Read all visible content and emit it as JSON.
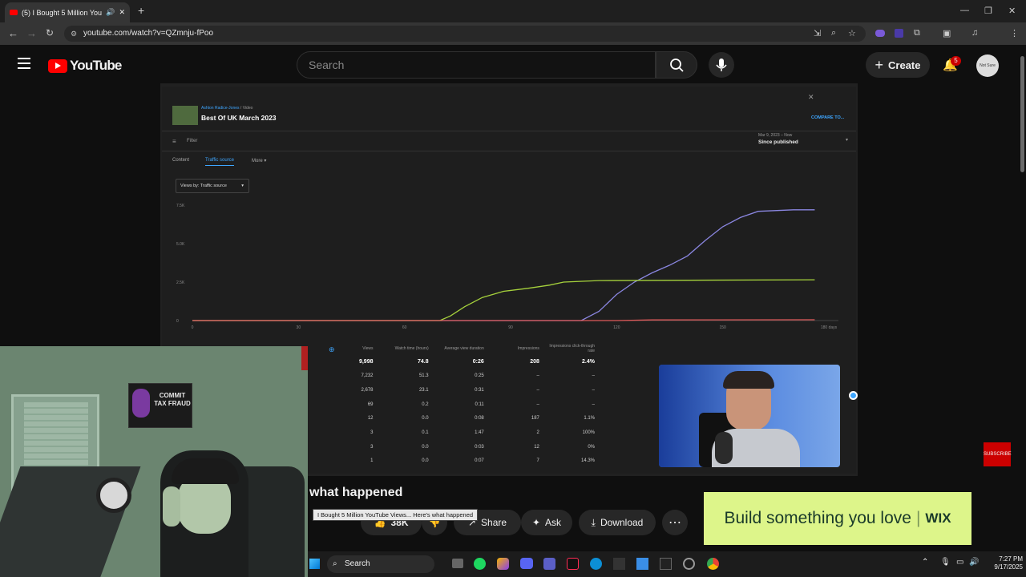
{
  "browser": {
    "tab_title": "(5) I Bought 5 Million YouTu",
    "url": "youtube.com/watch?v=QZmnju-fPoo"
  },
  "youtube": {
    "logo_text": "YouTube",
    "search_placeholder": "Search",
    "create_label": "Create",
    "notification_count": "5",
    "avatar_text": "Not Sure"
  },
  "studio": {
    "breadcrumb_channel": "Ashton Radice-Jones",
    "breadcrumb_page": "Video",
    "video_name": "Best Of UK March 2023",
    "filter_label": "Filter",
    "compare_label": "COMPARE TO...",
    "date_range_top": "Mar 9, 2023 – Now",
    "date_range_main": "Since published",
    "tabs": [
      "Content",
      "Traffic source",
      "More"
    ],
    "dropdown_label": "Views by: Traffic source",
    "table_headers": [
      "Views",
      "Watch time (hours)",
      "Average view duration",
      "Impressions",
      "Impressions click-through rate"
    ],
    "table_rows": [
      [
        "9,998",
        "74.8",
        "0:26",
        "208",
        "2.4%"
      ],
      [
        "7,232",
        "51.3",
        "0:25",
        "–",
        "–"
      ],
      [
        "2,678",
        "23.1",
        "0:31",
        "–",
        "–"
      ],
      [
        "69",
        "0.2",
        "0:11",
        "–",
        "–"
      ],
      [
        "12",
        "0.0",
        "0:08",
        "187",
        "1.1%"
      ],
      [
        "3",
        "0.1",
        "1:47",
        "2",
        "100%"
      ],
      [
        "3",
        "0.0",
        "0:03",
        "12",
        "0%"
      ],
      [
        "1",
        "0.0",
        "0:07",
        "7",
        "14.3%"
      ]
    ]
  },
  "chart_data": {
    "type": "line",
    "x": [
      0,
      30,
      60,
      90,
      120,
      150,
      180
    ],
    "x_tick_labels": [
      "0",
      "30",
      "60",
      "90",
      "120",
      "150",
      "180 days"
    ],
    "y_tick_labels": [
      "0",
      "2.5K",
      "5.0K",
      "7.5K"
    ],
    "ylim": [
      0,
      7500
    ],
    "xlim": [
      0,
      180
    ],
    "series": [
      {
        "color": "#8a86e0",
        "points": [
          [
            0,
            0
          ],
          [
            100,
            0
          ],
          [
            110,
            0
          ],
          [
            115,
            600
          ],
          [
            120,
            1700
          ],
          [
            125,
            2500
          ],
          [
            130,
            3100
          ],
          [
            135,
            3600
          ],
          [
            140,
            4200
          ],
          [
            145,
            5200
          ],
          [
            150,
            6100
          ],
          [
            155,
            6700
          ],
          [
            160,
            7100
          ],
          [
            170,
            7200
          ],
          [
            176,
            7200
          ]
        ]
      },
      {
        "color": "#a6d23c",
        "points": [
          [
            0,
            0
          ],
          [
            70,
            0
          ],
          [
            73,
            300
          ],
          [
            77,
            900
          ],
          [
            82,
            1500
          ],
          [
            88,
            1900
          ],
          [
            95,
            2100
          ],
          [
            101,
            2300
          ],
          [
            105,
            2500
          ],
          [
            115,
            2600
          ],
          [
            176,
            2650
          ]
        ]
      },
      {
        "color": "#e05a5a",
        "points": [
          [
            0,
            0
          ],
          [
            120,
            0
          ],
          [
            130,
            40
          ],
          [
            176,
            50
          ]
        ]
      }
    ]
  },
  "video": {
    "title_fragment": "what happened",
    "tooltip": "I Bought 5 Million YouTube Views... Here's what happened",
    "likes": "38K",
    "share_label": "Share",
    "ask_label": "Ask",
    "download_label": "Download",
    "subscribe_overlay": "SUBSCRIBE",
    "poster_text": "COMMIT TAX FRAUD"
  },
  "ad": {
    "headline": "Build something you love",
    "brand": "WIX"
  },
  "taskbar": {
    "search_label": "Search",
    "time": "7:27 PM",
    "date": "9/17/2025"
  }
}
